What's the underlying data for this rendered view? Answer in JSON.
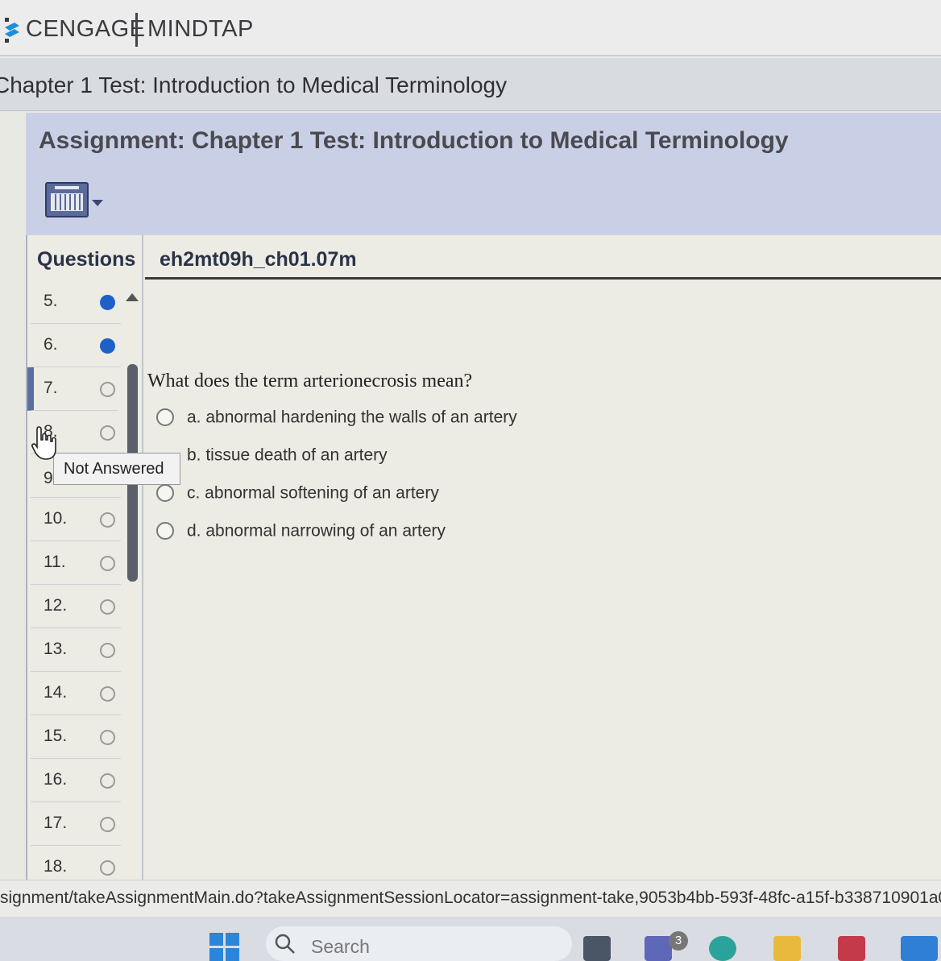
{
  "brand": {
    "name": "CENGAGE",
    "product": "MINDTAP"
  },
  "chapter_title": "Chapter 1 Test: Introduction to Medical Terminology",
  "assignment_title": "Assignment: Chapter 1 Test: Introduction to Medical Terminology",
  "toolbar": {
    "keyboard_icon": "keyboard-icon"
  },
  "questions_panel": {
    "header": "Questions",
    "items": [
      {
        "num": "5.",
        "status": "answered"
      },
      {
        "num": "6.",
        "status": "answered"
      },
      {
        "num": "7.",
        "status": "unanswered",
        "current": true
      },
      {
        "num": "8.",
        "status": "unanswered"
      },
      {
        "num": "9",
        "status": "unanswered"
      },
      {
        "num": "10.",
        "status": "unanswered"
      },
      {
        "num": "11.",
        "status": "unanswered"
      },
      {
        "num": "12.",
        "status": "unanswered"
      },
      {
        "num": "13.",
        "status": "unanswered"
      },
      {
        "num": "14.",
        "status": "unanswered"
      },
      {
        "num": "15.",
        "status": "unanswered"
      },
      {
        "num": "16.",
        "status": "unanswered"
      },
      {
        "num": "17.",
        "status": "unanswered"
      },
      {
        "num": "18.",
        "status": "unanswered"
      }
    ],
    "tooltip": "Not Answered"
  },
  "item_id": "eh2mt09h_ch01.07m",
  "question": {
    "prompt": "What does the term arterionecrosis mean?",
    "choices": [
      "a. abnormal hardening the walls of an artery",
      "b. tissue death of an artery",
      "c. abnormal softening of an artery",
      "d. abnormal narrowing of an artery"
    ]
  },
  "url": "signment/takeAssignmentMain.do?takeAssignmentSessionLocator=assignment-take,9053b4bb-593f-48fc-a15f-b338710901a0",
  "taskbar": {
    "search_placeholder": "Search",
    "notification_count": "3"
  },
  "colors": {
    "answered_dot": "#1f5fc8",
    "assignment_band": "#c9d0e6",
    "accent": "#5a6fa0"
  }
}
